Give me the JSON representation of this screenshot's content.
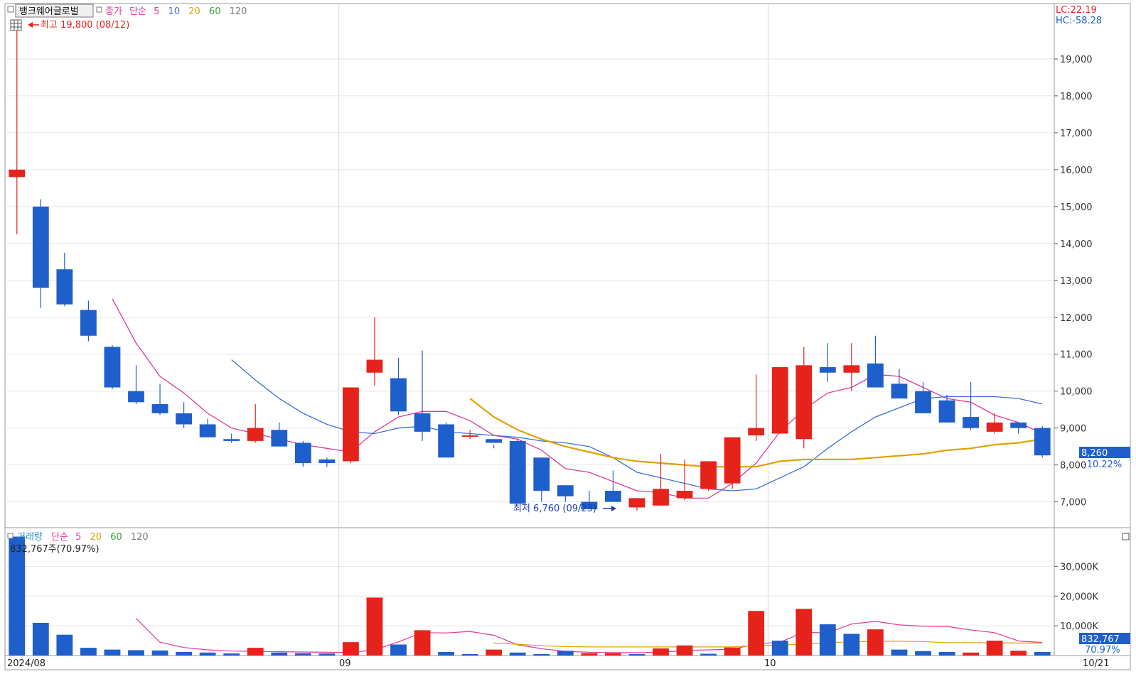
{
  "header": {
    "stock_name": "뱅크웨어글로벌",
    "price_kind": "종가",
    "ma_kind": "단순",
    "ma_periods": [
      "5",
      "10",
      "20",
      "60",
      "120"
    ],
    "ma_colors": [
      "#e0399b",
      "#3a6fd8",
      "#e0a200",
      "#3a9a3a",
      "#777777"
    ]
  },
  "right_corner": {
    "lc": "LC:22.19",
    "hc": "HC:-58.28"
  },
  "annotations": {
    "high": "최고 19,800 (08/12)",
    "low": "최저 6,760 (09/23)"
  },
  "price_badge": {
    "value": "8,260",
    "change": "-10.22%"
  },
  "volume_header": {
    "title": "거래량",
    "ma_kind": "단순",
    "ma_periods": [
      "5",
      "20",
      "60",
      "120"
    ],
    "ma_colors": [
      "#e0399b",
      "#e0a200",
      "#3a9a3a",
      "#777777"
    ],
    "current_value_text": "832,767주(70.97%)"
  },
  "volume_badge": {
    "value": "832,767",
    "pct": "70.97%"
  },
  "x_labels": {
    "start": "2024/08",
    "sep": "09",
    "oct": "10",
    "end": "10/21"
  },
  "colors": {
    "up": "#e5231b",
    "down": "#1f5fcc",
    "ma5": "#e0399b",
    "ma10": "#3a6fd8",
    "ma20": "#e0a200"
  },
  "chart_data": [
    {
      "type": "candlestick",
      "title": "뱅크웨어글로벌",
      "x": [
        "08/12",
        "08/13",
        "08/14",
        "08/16",
        "08/19",
        "08/20",
        "08/21",
        "08/22",
        "08/23",
        "08/26",
        "08/27",
        "08/28",
        "08/29",
        "08/30",
        "09/02",
        "09/03",
        "09/04",
        "09/05",
        "09/06",
        "09/09",
        "09/10",
        "09/11",
        "09/12",
        "09/13",
        "09/19",
        "09/20",
        "09/23",
        "09/24",
        "09/25",
        "09/26",
        "09/27",
        "09/30",
        "10/02",
        "10/04",
        "10/07",
        "10/08",
        "10/10",
        "10/11",
        "10/14",
        "10/15",
        "10/16",
        "10/17",
        "10/18",
        "10/21"
      ],
      "open": [
        15800,
        15000,
        13300,
        12200,
        11200,
        10000,
        9650,
        9400,
        9100,
        8700,
        8650,
        8950,
        8600,
        8150,
        8100,
        10500,
        10350,
        9400,
        9100,
        8800,
        8700,
        8650,
        8200,
        7450,
        7000,
        7300,
        6850,
        6900,
        7100,
        7350,
        7500,
        8800,
        8850,
        8700,
        10650,
        10500,
        10750,
        10200,
        10000,
        9750,
        9300,
        8900,
        9150,
        9000
      ],
      "high": [
        19800,
        15200,
        13750,
        12450,
        11250,
        10700,
        10200,
        9700,
        9250,
        8850,
        9650,
        9150,
        8650,
        8200,
        10050,
        12000,
        10900,
        11100,
        9150,
        8950,
        8450,
        8700,
        8050,
        7300,
        7300,
        7850,
        7100,
        8300,
        8150,
        7450,
        8100,
        10450,
        9950,
        11200,
        11300,
        11300,
        11500,
        10600,
        10250,
        9900,
        10250,
        9400,
        9150,
        9050
      ],
      "low": [
        14250,
        12250,
        12300,
        11350,
        10050,
        9650,
        9350,
        9000,
        8750,
        8600,
        8600,
        8500,
        7950,
        7950,
        8050,
        10150,
        9350,
        8650,
        8200,
        8700,
        8550,
        7000,
        7000,
        7000,
        6800,
        7150,
        6760,
        6900,
        7050,
        7300,
        7350,
        8650,
        8950,
        8450,
        10250,
        10000,
        10100,
        9900,
        9850,
        9200,
        8950,
        8850,
        8850,
        8200
      ],
      "close": [
        16000,
        12800,
        12350,
        11500,
        10100,
        9700,
        9400,
        9100,
        8750,
        8650,
        9000,
        8500,
        8050,
        8050,
        10100,
        10850,
        9450,
        8900,
        8200,
        8800,
        8600,
        6950,
        7300,
        7150,
        6800,
        7000,
        7100,
        7350,
        7300,
        8100,
        8750,
        9000,
        10650,
        10700,
        10500,
        10700,
        10100,
        9800,
        9400,
        9150,
        9000,
        9150,
        9000,
        8260
      ],
      "ma": {
        "5": [
          null,
          null,
          null,
          null,
          12500,
          11300,
          10400,
          9950,
          9400,
          9000,
          8850,
          8700,
          8550,
          8450,
          8350,
          8900,
          9300,
          9450,
          9450,
          9200,
          8800,
          8700,
          8400,
          7900,
          7800,
          7550,
          7300,
          7250,
          7100,
          7100,
          7500,
          8050,
          8900,
          9500,
          9950,
          10100,
          10450,
          10400,
          10100,
          9800,
          9700,
          9350,
          9150,
          8850
        ],
        "10": [
          null,
          null,
          null,
          null,
          null,
          null,
          null,
          null,
          null,
          10850,
          10300,
          9800,
          9400,
          9100,
          8900,
          8850,
          9000,
          9050,
          8900,
          8850,
          8800,
          8750,
          8650,
          8600,
          8500,
          8200,
          7800,
          7650,
          7500,
          7350,
          7300,
          7350,
          7650,
          7950,
          8450,
          8900,
          9300,
          9550,
          9800,
          9850,
          9850,
          9850,
          9800,
          9650
        ],
        "20": [
          null,
          null,
          null,
          null,
          null,
          null,
          null,
          null,
          null,
          null,
          null,
          null,
          null,
          null,
          null,
          null,
          null,
          null,
          null,
          9800,
          9300,
          8950,
          8700,
          8500,
          8350,
          8200,
          8100,
          8050,
          8000,
          7950,
          7950,
          7950,
          8100,
          8150,
          8150,
          8150,
          8200,
          8250,
          8300,
          8400,
          8450,
          8550,
          8600,
          8700
        ]
      },
      "ylim": [
        6300,
        20500
      ],
      "yticks": [
        "7,000",
        "8,000",
        "9,000",
        "10,000",
        "11,000",
        "12,000",
        "13,000",
        "14,000",
        "15,000",
        "16,000",
        "17,000",
        "18,000",
        "19,000"
      ],
      "grid": true
    },
    {
      "type": "bar",
      "title": "거래량",
      "x": [
        "08/12",
        "08/13",
        "08/14",
        "08/16",
        "08/19",
        "08/20",
        "08/21",
        "08/22",
        "08/23",
        "08/26",
        "08/27",
        "08/28",
        "08/29",
        "08/30",
        "09/02",
        "09/03",
        "09/04",
        "09/05",
        "09/06",
        "09/09",
        "09/10",
        "09/11",
        "09/12",
        "09/13",
        "09/19",
        "09/20",
        "09/23",
        "09/24",
        "09/25",
        "09/26",
        "09/27",
        "09/30",
        "10/02",
        "10/04",
        "10/07",
        "10/08",
        "10/10",
        "10/11",
        "10/14",
        "10/15",
        "10/16",
        "10/17",
        "10/18",
        "10/21"
      ],
      "values": [
        40000,
        11000,
        7000,
        2600,
        2000,
        1800,
        1700,
        1200,
        1000,
        700,
        2600,
        1000,
        800,
        700,
        4500,
        19500,
        3700,
        8500,
        1200,
        500,
        2000,
        1000,
        500,
        1600,
        800,
        800,
        500,
        2400,
        3400,
        600,
        2700,
        15000,
        5000,
        15700,
        10500,
        7300,
        8800,
        2000,
        1500,
        1200,
        1000,
        5000,
        1600,
        1200
      ],
      "up": [
        false,
        false,
        false,
        false,
        false,
        false,
        false,
        false,
        false,
        false,
        true,
        false,
        false,
        false,
        true,
        true,
        false,
        true,
        false,
        false,
        true,
        false,
        false,
        false,
        true,
        true,
        false,
        true,
        true,
        false,
        true,
        true,
        false,
        true,
        false,
        false,
        true,
        false,
        false,
        false,
        true,
        true,
        true,
        false
      ],
      "ma": {
        "5": [
          null,
          null,
          null,
          null,
          null,
          12500,
          4500,
          2700,
          1900,
          1500,
          1400,
          1300,
          1200,
          1100,
          1000,
          1900,
          4600,
          7700,
          7600,
          8100,
          6800,
          3600,
          2300,
          1400,
          1100,
          1000,
          1000,
          1100,
          1700,
          1900,
          2100,
          3900,
          4500,
          7800,
          7600,
          10600,
          11500,
          10300,
          9900,
          9800,
          8600,
          7700,
          4900,
          4400
        ],
        "20": [
          null,
          null,
          null,
          null,
          null,
          null,
          null,
          null,
          null,
          null,
          null,
          null,
          null,
          null,
          null,
          null,
          null,
          null,
          null,
          null,
          4200,
          3800,
          3300,
          3000,
          2900,
          2900,
          2900,
          2900,
          2900,
          2900,
          2900,
          3400,
          3500,
          3800,
          4300,
          4600,
          4800,
          4800,
          4700,
          4300,
          4300,
          4300,
          4200,
          4200
        ]
      },
      "ylim": [
        0,
        43000
      ],
      "yticks": [
        "10,000K",
        "20,000K",
        "30,000K"
      ],
      "grid": true
    }
  ]
}
